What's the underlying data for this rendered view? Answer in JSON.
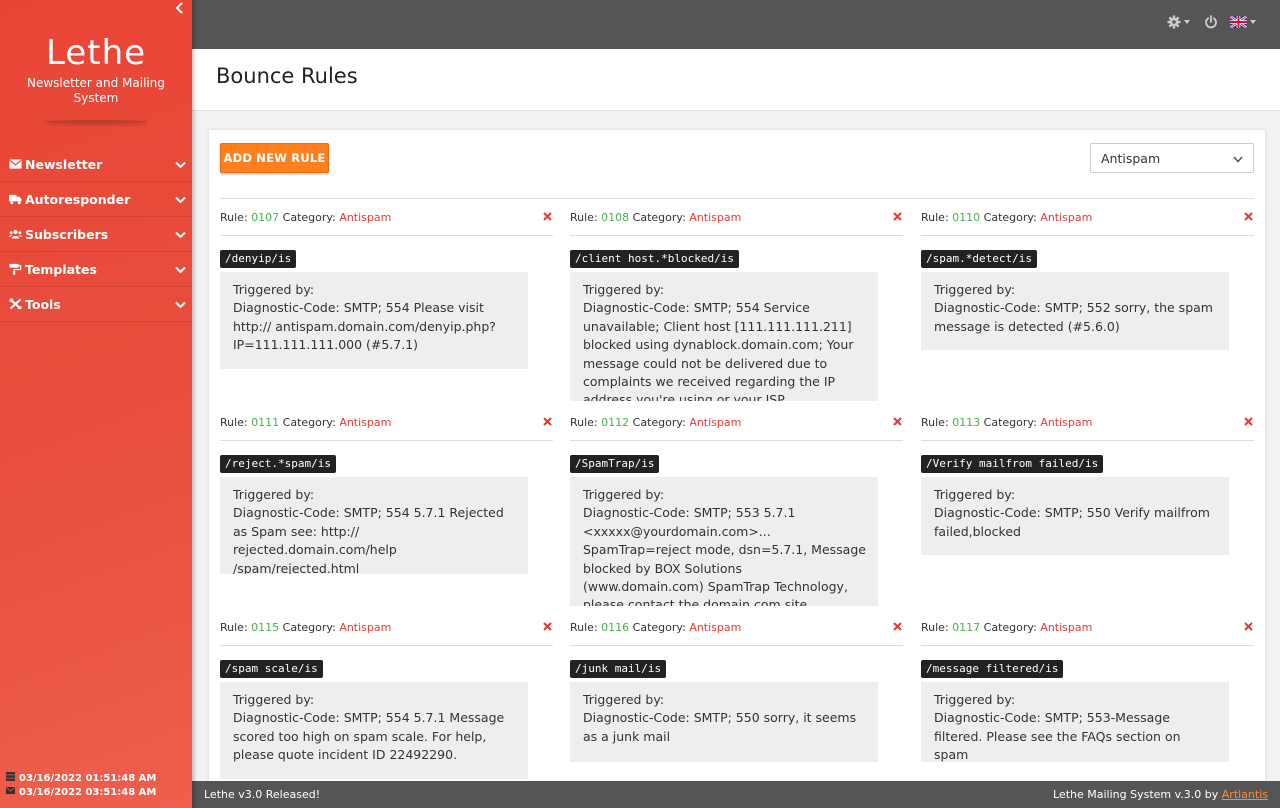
{
  "sidebar": {
    "logo": "Lethe",
    "tagline": "Newsletter and Mailing System",
    "items": [
      {
        "label": "Newsletter",
        "icon": "envelope-icon"
      },
      {
        "label": "Autoresponder",
        "icon": "truck-icon"
      },
      {
        "label": "Subscribers",
        "icon": "users-icon"
      },
      {
        "label": "Templates",
        "icon": "paint-roller-icon"
      },
      {
        "label": "Tools",
        "icon": "tools-icon"
      }
    ],
    "footer": {
      "line1": "03/16/2022 01:51:48 AM",
      "line2": "03/16/2022 03:51:48 AM"
    }
  },
  "topbar": {
    "icons": [
      "gear-icon",
      "power-icon",
      "uk-flag-icon"
    ]
  },
  "page": {
    "title": "Bounce Rules"
  },
  "toolbar": {
    "add_label": "ADD NEW RULE",
    "category_selected": "Antispam"
  },
  "labels": {
    "rule": "Rule:",
    "category": "Category:",
    "triggered_by": "Triggered by:"
  },
  "rules": [
    {
      "id": "0107",
      "category": "Antispam",
      "pattern": "/denyip/is",
      "trigger": "Diagnostic-Code: SMTP; 554 Please visit http:// antispam.domain.com/denyip.php?IP=111.111.111.000 (#5.7.1)"
    },
    {
      "id": "0108",
      "category": "Antispam",
      "pattern": "/client host.*blocked/is",
      "trigger": "Diagnostic-Code: SMTP; 554 Service unavailable; Client host [111.111.111.211] blocked using dynablock.domain.com; Your message could not be delivered due to complaints we received regarding the IP address you're using or your ISP."
    },
    {
      "id": "0110",
      "category": "Antispam",
      "pattern": "/spam.*detect/is",
      "trigger": "Diagnostic-Code: SMTP; 552 sorry, the spam message is detected (#5.6.0)"
    },
    {
      "id": "0111",
      "category": "Antispam",
      "pattern": "/reject.*spam/is",
      "trigger": "Diagnostic-Code: SMTP; 554 5.7.1 Rejected as Spam see: http:// rejected.domain.com/help /spam/rejected.html"
    },
    {
      "id": "0112",
      "category": "Antispam",
      "pattern": "/SpamTrap/is",
      "trigger": "Diagnostic-Code: SMTP; 553 5.7.1 <xxxxx@yourdomain.com>... SpamTrap=reject mode, dsn=5.7.1, Message blocked by BOX Solutions (www.domain.com) SpamTrap Technology, please contact the domain.com site manager for help."
    },
    {
      "id": "0113",
      "category": "Antispam",
      "pattern": "/Verify mailfrom failed/is",
      "trigger": "Diagnostic-Code: SMTP; 550 Verify mailfrom failed,blocked"
    },
    {
      "id": "0115",
      "category": "Antispam",
      "pattern": "/spam scale/is",
      "trigger": "Diagnostic-Code: SMTP; 554 5.7.1 Message scored too high on spam scale. For help, please quote incident ID 22492290."
    },
    {
      "id": "0116",
      "category": "Antispam",
      "pattern": "/junk mail/is",
      "trigger": "Diagnostic-Code: SMTP; 550 sorry, it seems as a junk mail"
    },
    {
      "id": "0117",
      "category": "Antispam",
      "pattern": "/message filtered/is",
      "trigger": "Diagnostic-Code: SMTP; 553-Message filtered. Please see the FAQs section on spam"
    }
  ],
  "footer": {
    "left": "Lethe v3.0 Released!",
    "right_text": "Lethe Mailing System v.3.0 by",
    "right_link": "Artlantis"
  },
  "colors": {
    "sidebar": "#e94536",
    "accent_button": "#ff7f1e",
    "rule_id": "#4caf50",
    "category": "#e53935",
    "topbar": "#555555"
  }
}
